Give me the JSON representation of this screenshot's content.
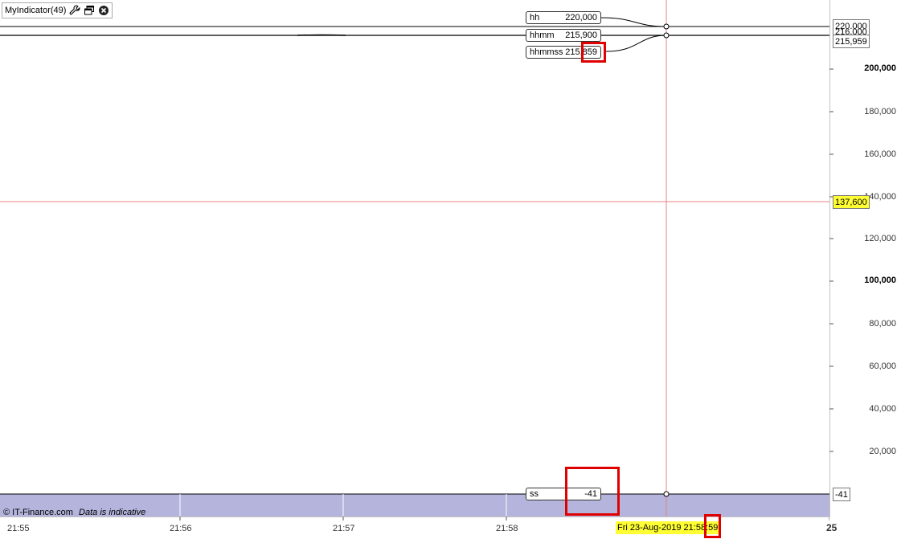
{
  "indicator": {
    "title": "MyIndicator(49)",
    "icons": [
      "wrench-icon",
      "window-icon",
      "close-icon"
    ]
  },
  "labels": {
    "hh": {
      "name": "hh",
      "value": "220,000"
    },
    "hhmm": {
      "name": "hhmm",
      "value": "215,900"
    },
    "hhmmss": {
      "name": "hhmmss",
      "value_prefix": "215",
      "value_suffix": ",859"
    },
    "ss": {
      "name": "ss",
      "value": "-41"
    }
  },
  "y_axis": {
    "ticks": [
      {
        "text": "200,000",
        "major": true
      },
      {
        "text": "180,000",
        "major": false
      },
      {
        "text": "160,000",
        "major": false
      },
      {
        "text": "140,000",
        "major": false
      },
      {
        "text": "120,000",
        "major": false
      },
      {
        "text": "100,000",
        "major": true
      },
      {
        "text": "80,000",
        "major": false
      },
      {
        "text": "60,000",
        "major": false
      },
      {
        "text": "40,000",
        "major": false
      },
      {
        "text": "20,000",
        "major": false
      }
    ],
    "tags": {
      "hh": "220,000",
      "hhmm_hidden": "216,000",
      "hhmmss": "215,959",
      "cursor": "137,600",
      "ss": "-41"
    }
  },
  "x_axis": {
    "ticks": [
      "21:55",
      "21:56",
      "21:57",
      "21:58",
      "25"
    ],
    "cursor_label_prefix": "Fri 23-Aug-2019 21:58:",
    "cursor_label_suffix": "59"
  },
  "footer": {
    "copyright": "© IT-Finance.com",
    "disclaimer": "Data is indicative"
  },
  "colors": {
    "cursor_line": "#e88080",
    "band": "#b4b4dc",
    "highlight": "#ffff33",
    "annotation": "#e00000"
  }
}
